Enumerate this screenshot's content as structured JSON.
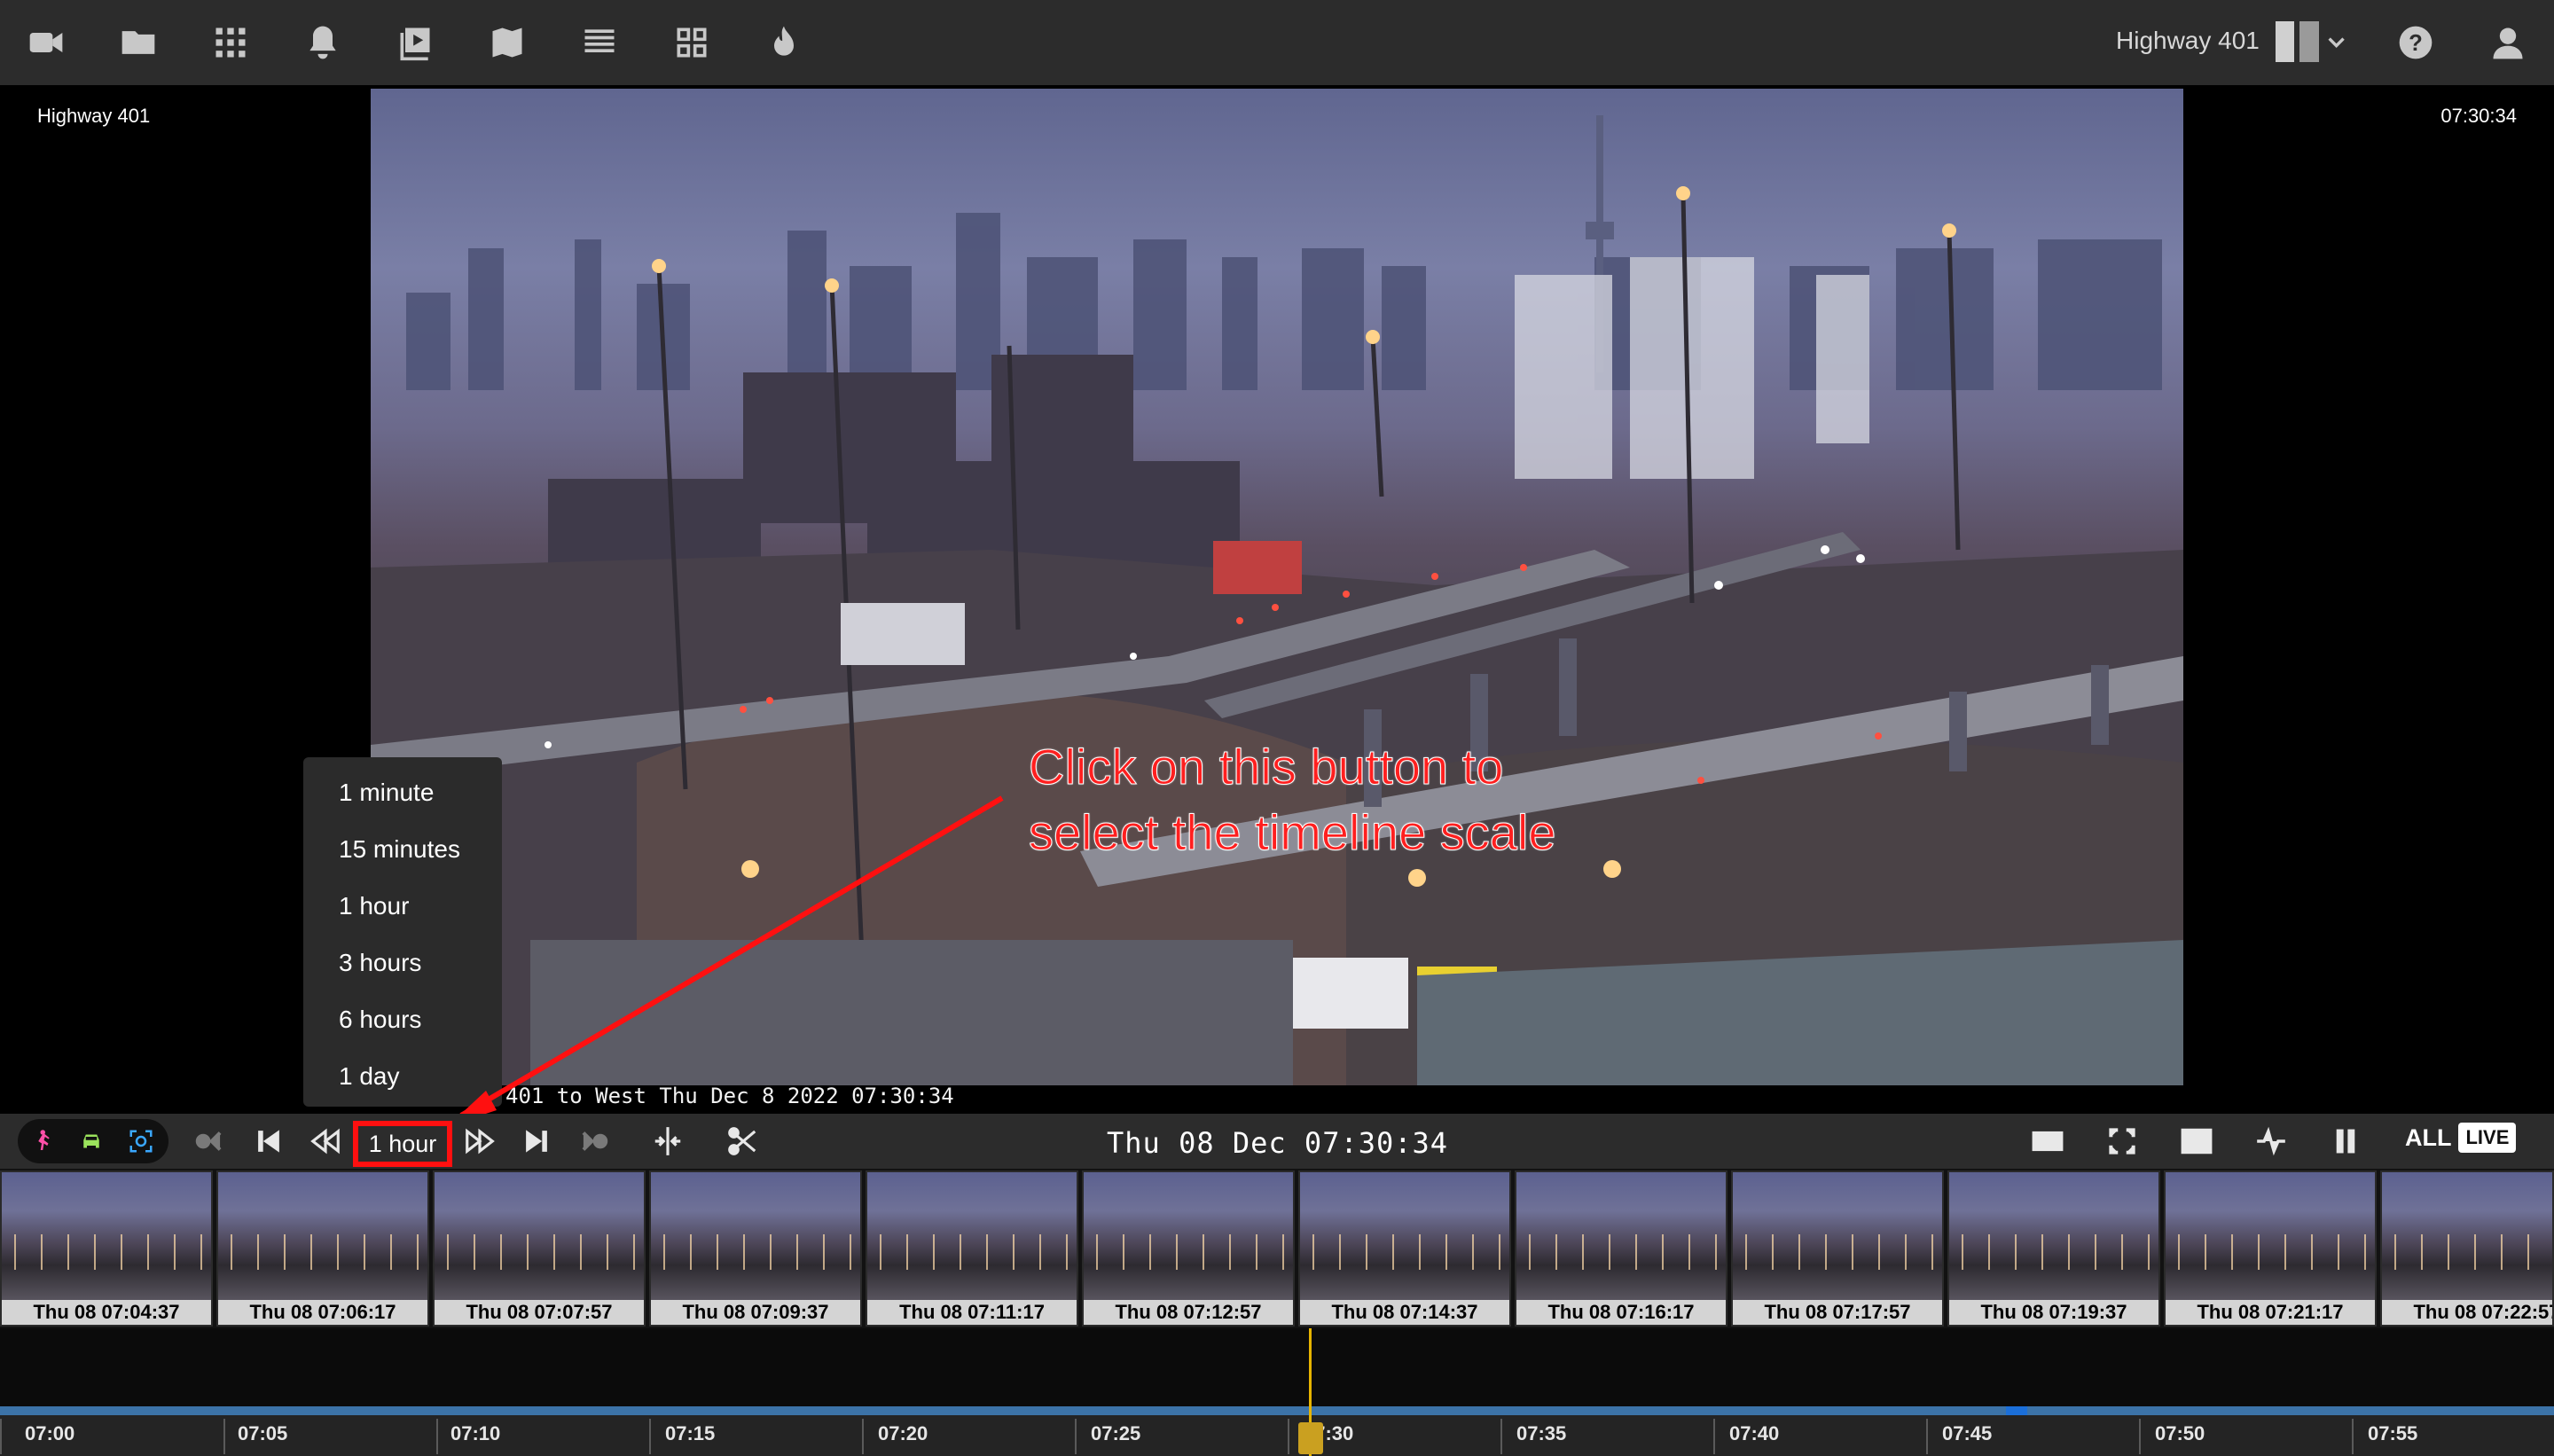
{
  "toolbar": {
    "icons": [
      "camera-icon",
      "folder-icon",
      "grid-apps-icon",
      "bell-icon",
      "playback-icon",
      "map-icon",
      "list-icon",
      "tiles-icon",
      "fire-icon"
    ],
    "camera_name": "Highway 401",
    "right_icons": [
      "layout-icon",
      "help-icon",
      "user-icon"
    ]
  },
  "video": {
    "camera_label": "Highway 401",
    "clock": "07:30:34",
    "osd": "401 to West Thu Dec  8 2022 07:30:34"
  },
  "scale_menu": {
    "options": [
      "1 minute",
      "15 minutes",
      "1 hour",
      "3 hours",
      "6 hours",
      "1 day"
    ]
  },
  "annotation": {
    "line1": "Click on this button to",
    "line2": "select  the timeline scale",
    "color": "#ff1f1f"
  },
  "controls": {
    "scale_label": "1 hour",
    "current_time": "Thu 08 Dec  07:30:34",
    "all_label": "ALL",
    "live_label": "LIVE",
    "detection_colors": {
      "person": "#ff4fa8",
      "vehicle": "#9be35c",
      "motion": "#3aa7ff"
    }
  },
  "thumbnails": [
    "Thu 08 07:04:37",
    "Thu 08 07:06:17",
    "Thu 08 07:07:57",
    "Thu 08 07:09:37",
    "Thu 08 07:11:17",
    "Thu 08 07:12:57",
    "Thu 08 07:14:37",
    "Thu 08 07:16:17",
    "Thu 08 07:17:57",
    "Thu 08 07:19:37",
    "Thu 08 07:21:17",
    "Thu 08 07:22:57"
  ],
  "timeline": {
    "labels": [
      "07:00",
      "07:05",
      "07:10",
      "07:15",
      "07:20",
      "07:25",
      "07:30",
      "07:35",
      "07:40",
      "07:45",
      "07:50",
      "07:55"
    ],
    "playhead_color": "#e6b400"
  }
}
